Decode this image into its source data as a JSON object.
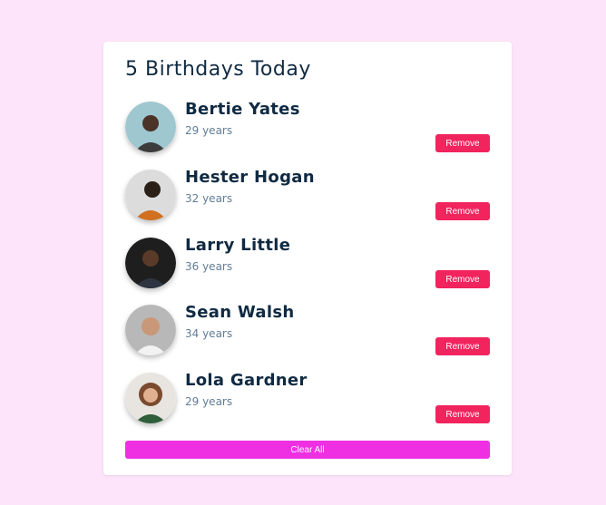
{
  "title": "5 Birthdays Today",
  "people": [
    {
      "name": "Bertie Yates",
      "age": "29 years",
      "remove_label": "Remove",
      "avatar_bg": "#9ec7d0",
      "avatar_fg": "#4b3328"
    },
    {
      "name": "Hester Hogan",
      "age": "32 years",
      "remove_label": "Remove",
      "avatar_bg": "#dcdcdc",
      "avatar_fg": "#2b2018"
    },
    {
      "name": "Larry Little",
      "age": "36 years",
      "remove_label": "Remove",
      "avatar_bg": "#1e1e1e",
      "avatar_fg": "#5a3a28"
    },
    {
      "name": "Sean Walsh",
      "age": "34 years",
      "remove_label": "Remove",
      "avatar_bg": "#b8b8b8",
      "avatar_fg": "#6e5040"
    },
    {
      "name": "Lola Gardner",
      "age": "29 years",
      "remove_label": "Remove",
      "avatar_bg": "#e8e4df",
      "avatar_fg": "#7a4a2e"
    }
  ],
  "clear_label": "Clear All",
  "colors": {
    "background": "#fde4fa",
    "remove_button": "#f1245e",
    "clear_button": "#ee30e2",
    "name_text": "#102a42",
    "age_text": "#617d98"
  }
}
